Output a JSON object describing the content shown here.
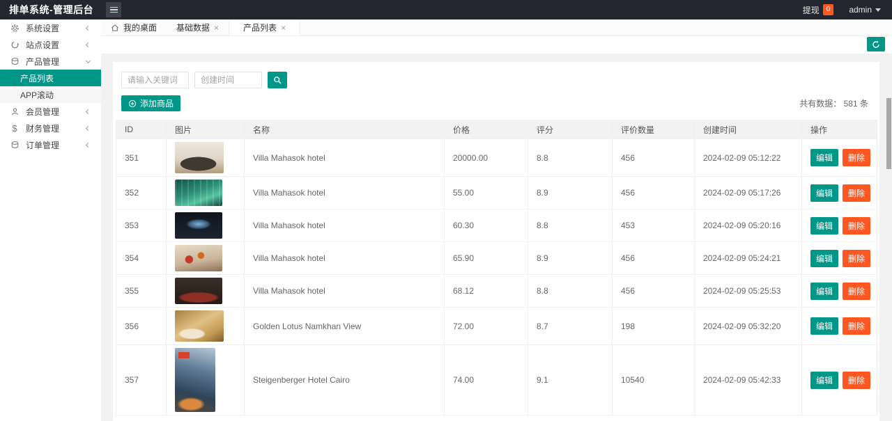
{
  "app": {
    "title": "排单系统-管理后台"
  },
  "topbar": {
    "menu_icon": "hamburger-icon",
    "withdraw_label": "提现",
    "withdraw_badge": "0",
    "user": "admin",
    "user_caret_icon": "chevron-down-icon"
  },
  "sidebar": {
    "items": [
      {
        "label": "系统设置",
        "icon": "gear-icon",
        "state": "collapsed"
      },
      {
        "label": "站点设置",
        "icon": "sync-icon",
        "state": "collapsed"
      },
      {
        "label": "产品管理",
        "icon": "coins-icon",
        "state": "expanded"
      },
      {
        "label": "会员管理",
        "icon": "user-icon",
        "state": "collapsed"
      },
      {
        "label": "财务管理",
        "icon": "dollar-icon",
        "state": "collapsed"
      },
      {
        "label": "订单管理",
        "icon": "coins-icon",
        "state": "collapsed"
      }
    ],
    "product_children": [
      {
        "label": "产品列表",
        "active": true
      },
      {
        "label": "APP滚动",
        "active": false
      }
    ]
  },
  "tabs": [
    {
      "label": "我的桌面",
      "icon": "home-icon",
      "closable": false,
      "active": false
    },
    {
      "label": "基础数据",
      "close_icon": "close-icon",
      "closable": true,
      "active": false
    },
    {
      "label": "产品列表",
      "close_icon": "close-icon",
      "closable": true,
      "active": true
    }
  ],
  "toolbar": {
    "refresh_icon": "refresh-icon"
  },
  "filters": {
    "keyword_placeholder": "请输入关键词",
    "date_placeholder": "创建时间",
    "search_icon": "search-icon",
    "add_button_label": "添加商品",
    "add_button_icon": "plus-circle-icon",
    "total_label": "共有数据：",
    "total_count": "581",
    "total_unit": "条"
  },
  "table": {
    "columns": [
      "ID",
      "图片",
      "名称",
      "价格",
      "评分",
      "评价数量",
      "创建时间",
      "操作"
    ],
    "edit_label": "编辑",
    "delete_label": "删除",
    "rows": [
      {
        "id": "351",
        "image": "hotel-room-photo",
        "name": "Villa Mahasok hotel",
        "price": "20000.00",
        "rating": "8.8",
        "reviews": "456",
        "created": "2024-02-09 05:12:22"
      },
      {
        "id": "352",
        "image": "green-building-photo",
        "name": "Villa Mahasok hotel",
        "price": "55.00",
        "rating": "8.9",
        "reviews": "456",
        "created": "2024-02-09 05:17:26"
      },
      {
        "id": "353",
        "image": "dark-lounge-photo",
        "name": "Villa Mahasok hotel",
        "price": "60.30",
        "rating": "8.8",
        "reviews": "453",
        "created": "2024-02-09 05:20:16"
      },
      {
        "id": "354",
        "image": "warm-interior-photo",
        "name": "Villa Mahasok hotel",
        "price": "65.90",
        "rating": "8.9",
        "reviews": "456",
        "created": "2024-02-09 05:24:21"
      },
      {
        "id": "355",
        "image": "restaurant-photo",
        "name": "Villa Mahasok hotel",
        "price": "68.12",
        "rating": "8.8",
        "reviews": "456",
        "created": "2024-02-09 05:25:53"
      },
      {
        "id": "356",
        "image": "gold-dining-photo",
        "name": "Golden Lotus Namkhan View",
        "price": "72.00",
        "rating": "8.7",
        "reviews": "198",
        "created": "2024-02-09 05:32:20"
      },
      {
        "id": "357",
        "image": "hotel-facade-photo",
        "name": "Steigenberger Hotel Cairo",
        "price": "74.00",
        "rating": "9.1",
        "reviews": "10540",
        "created": "2024-02-09 05:42:33"
      }
    ]
  },
  "colors": {
    "accent": "#009688",
    "danger": "#ff5722",
    "topbar_bg": "#23262e",
    "page_bg": "#f2f2f2"
  }
}
